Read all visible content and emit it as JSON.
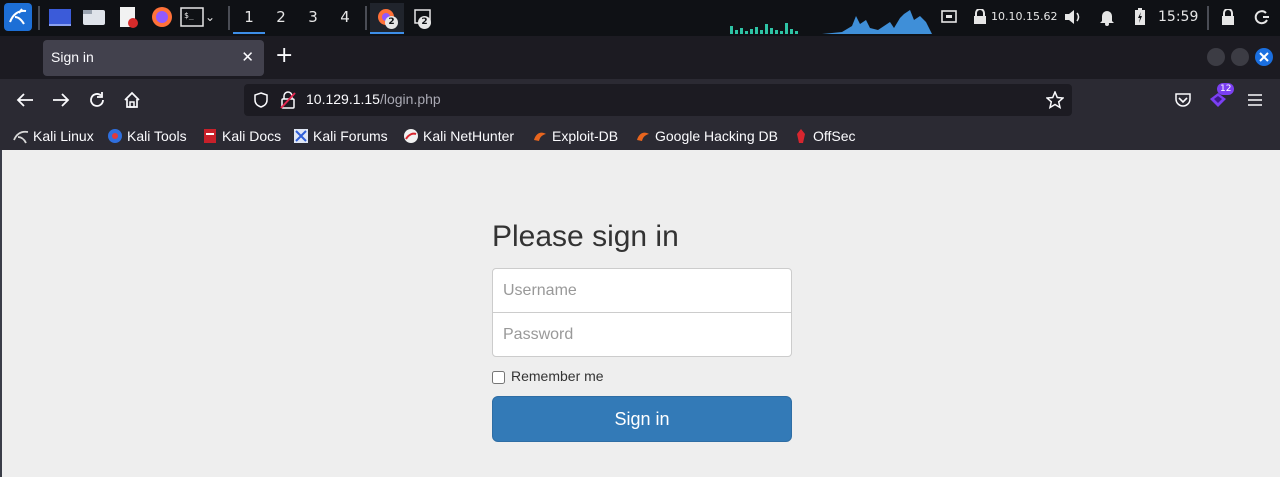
{
  "panel": {
    "workspaces": [
      "1",
      "2",
      "3",
      "4"
    ],
    "active_workspace": "1",
    "task_badges": [
      "2",
      "2"
    ],
    "ip_address": "10.10.15.62",
    "clock": "15:59"
  },
  "browser": {
    "tab_title": "Sign in",
    "url_host": "10.129.1.15",
    "url_path": "/login.php",
    "extension_badge": "12",
    "bookmarks": [
      "Kali Linux",
      "Kali Tools",
      "Kali Docs",
      "Kali Forums",
      "Kali NetHunter",
      "Exploit-DB",
      "Google Hacking DB",
      "OffSec"
    ]
  },
  "login": {
    "heading": "Please sign in",
    "username_placeholder": "Username",
    "password_placeholder": "Password",
    "remember_label": "Remember me",
    "submit_label": "Sign in"
  },
  "colors": {
    "panel_bg": "#0f1115",
    "accent": "#3d8ee8",
    "button": "#337ab7",
    "page_bg": "#eeeeee"
  }
}
